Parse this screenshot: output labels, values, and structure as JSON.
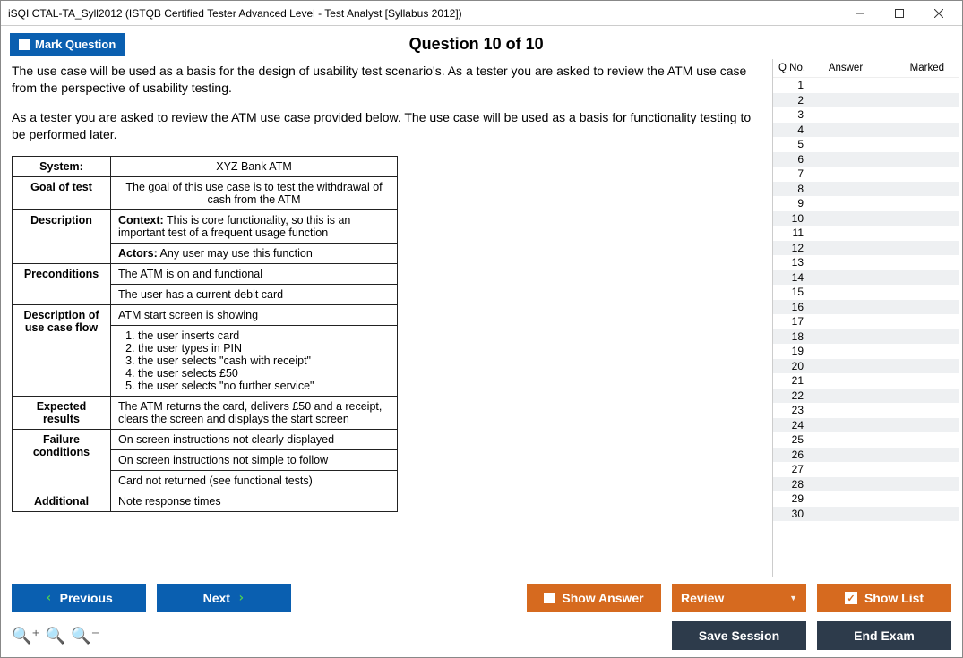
{
  "window_title": "iSQI CTAL-TA_Syll2012 (ISTQB Certified Tester Advanced Level - Test Analyst [Syllabus 2012])",
  "mark_question_label": "Mark Question",
  "question_header": "Question 10 of 10",
  "intro_p1": "The use case will be used as a basis for the design of usability test scenario's. As a tester you are asked to review the ATM use case from the perspective of usability testing.",
  "intro_p2": "As a tester you are asked to review the ATM use case provided below. The use case will be used as a basis for functionality testing to be performed later.",
  "usecase": {
    "system_label": "System:",
    "system_val": "XYZ Bank ATM",
    "goal_label": "Goal of test",
    "goal_val": "The goal of this use case is to test the withdrawal of cash from the ATM",
    "desc_label": "Description",
    "desc_context_strong": "Context:",
    "desc_context_rest": " This is core functionality, so this is an important test of a frequent usage function",
    "desc_actors_strong": "Actors:",
    "desc_actors_rest": " Any user may use this function",
    "precond_label": "Preconditions",
    "precond_1": "The ATM is on and functional",
    "precond_2": "The user has a current debit card",
    "flow_label": "Description of use case flow",
    "flow_intro": "ATM start screen is showing",
    "flow_steps": [
      "the user inserts card",
      "the user types in PIN",
      "the user selects \"cash with receipt\"",
      "the user selects £50",
      "the user selects \"no further service\""
    ],
    "expected_label": "Expected results",
    "expected_val": "The ATM returns the card, delivers £50 and a receipt, clears the screen and displays the start screen",
    "failure_label": "Failure conditions",
    "failure_1": "On screen instructions not clearly displayed",
    "failure_2": "On screen instructions not simple to follow",
    "failure_3": "Card not returned (see functional tests)",
    "additional_label": "Additional",
    "additional_val": "Note response times"
  },
  "qlist": {
    "col_qno": "Q No.",
    "col_answer": "Answer",
    "col_marked": "Marked",
    "count": 30
  },
  "buttons": {
    "previous": "Previous",
    "next": "Next",
    "show_answer": "Show Answer",
    "review": "Review",
    "show_list": "Show List",
    "save_session": "Save Session",
    "end_exam": "End Exam"
  }
}
